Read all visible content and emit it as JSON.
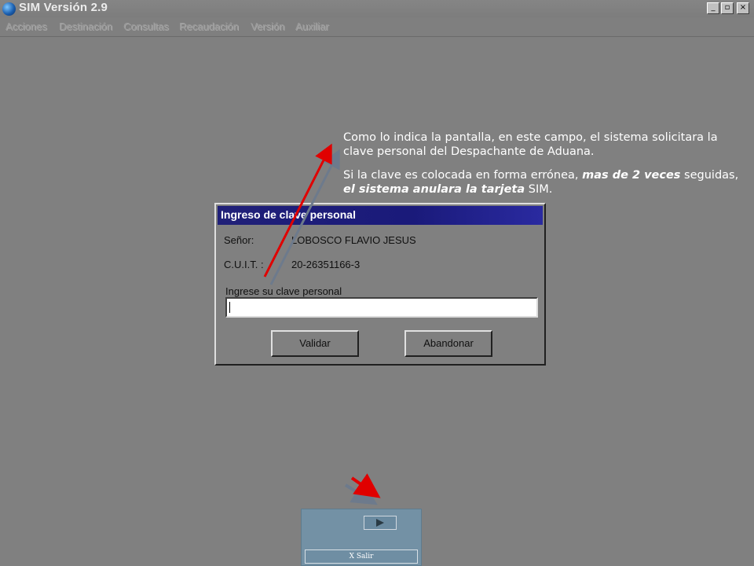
{
  "window": {
    "title": "SIM Versión 2.9",
    "minimize": "_",
    "maximize": "▫",
    "close": "×"
  },
  "menu": [
    {
      "label": "Acciones"
    },
    {
      "label": "Destinación"
    },
    {
      "label": "Consultas"
    },
    {
      "label": "Recaudación"
    },
    {
      "label": "Versión"
    },
    {
      "label": "Auxiliar"
    }
  ],
  "annotation": {
    "p1": "Como lo indica la pantalla, en este campo, el sistema solicitara la clave personal del Despachante de Aduana.",
    "p2_a": "Si la clave es colocada en forma errónea, ",
    "p2_b": "mas de 2 veces",
    "p2_c": " seguidas, ",
    "p2_d": "el sistema anulara la tarjeta",
    "p2_e": " SIM."
  },
  "dialog": {
    "title": "Ingreso de clave personal",
    "senor_label": "Señor:",
    "senor_value": "LOBOSCO FLAVIO JESUS",
    "cuit_label": "C.U.I.T. :",
    "cuit_value": "20-26351166-3",
    "password_label": "Ingrese su clave personal",
    "password_value": "",
    "validate_button": "Validar",
    "abandon_button": "Abandonar"
  },
  "navigation": {
    "exit_label": "X  Salir"
  },
  "colors": {
    "arrow_red": "#e00000",
    "arrow_grey": "#6d7a8c"
  }
}
